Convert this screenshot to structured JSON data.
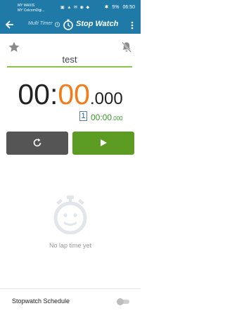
{
  "status_bar": {
    "carrier_1": "MY MAXIS",
    "carrier_2": "MY CelcomDigi...",
    "battery": "5%",
    "time": "06:50"
  },
  "app_bar": {
    "multi_timer_label": "Multi Timer",
    "title": "Stop Watch",
    "color": "#1f7aa8"
  },
  "stopwatch": {
    "name": "test",
    "minutes": "00",
    "colon": ":",
    "seconds": "00",
    "milliseconds": ".000",
    "seconds_color": "#f07c1a"
  },
  "lap": {
    "number": "1",
    "time_main": "00:00",
    "time_ms": ".000"
  },
  "controls": {
    "reset_color": "#555555",
    "start_color": "#5c9c22"
  },
  "laps_empty": {
    "message": "No lap time yet"
  },
  "schedule": {
    "label": "Stopwatch Schedule",
    "enabled": false
  },
  "icons": [
    "back-arrow-icon",
    "alarm-clock-icon",
    "stopwatch-icon",
    "more-vert-icon",
    "star-icon",
    "bell-off-icon",
    "reset-icon",
    "play-icon",
    "empty-stopwatch-icon"
  ]
}
